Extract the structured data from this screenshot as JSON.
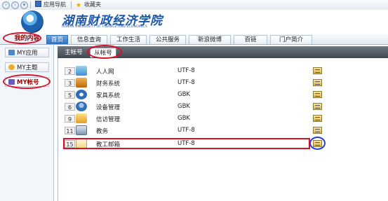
{
  "toolbar": {
    "items": [
      {
        "label": "应用导航",
        "icon": "grid-icon"
      },
      {
        "label": "收藏夹",
        "icon": "star-icon"
      }
    ]
  },
  "header": {
    "title": "湖南财政经济学院",
    "subtitle": "HUNAN UNIVERSITY OF FINANCE AND ECONOMICS"
  },
  "nav": {
    "my_content": "我的内容",
    "tabs": [
      "首页",
      "信息查询",
      "工作生活",
      "公共服务",
      "新浪微博",
      "百链",
      "门户简介"
    ]
  },
  "sidebar": {
    "items": [
      {
        "label": "MY应用",
        "icon": "app-icon"
      },
      {
        "label": "MY主题",
        "icon": "theme-icon"
      },
      {
        "label": "MY帐号",
        "icon": "account-icon"
      }
    ]
  },
  "subtabs": {
    "main": "主帐号",
    "sub": "从帐号"
  },
  "accounts": [
    {
      "num": "2",
      "name": "人人网",
      "encoding": "UTF-8",
      "icon": "renren-icon"
    },
    {
      "num": "3",
      "name": "财务系统",
      "encoding": "UTF-8",
      "icon": "finance-icon"
    },
    {
      "num": "5",
      "name": "家具系统",
      "encoding": "GBK",
      "icon": "furniture-icon"
    },
    {
      "num": "6",
      "name": "设备管理",
      "encoding": "GBK",
      "icon": "equipment-icon"
    },
    {
      "num": "9",
      "name": "信访管理",
      "encoding": "GBK",
      "icon": "petition-icon"
    },
    {
      "num": "11",
      "name": "教务",
      "encoding": "UTF-8",
      "icon": "academic-icon"
    },
    {
      "num": "15",
      "name": "教工邮箱",
      "encoding": "UTF-8",
      "icon": "mail-icon"
    }
  ],
  "colors": {
    "brand": "#1a56a8",
    "highlight_red": "#d8102a",
    "highlight_blue": "#2840d0",
    "active_tab": "#2f6fb8"
  }
}
